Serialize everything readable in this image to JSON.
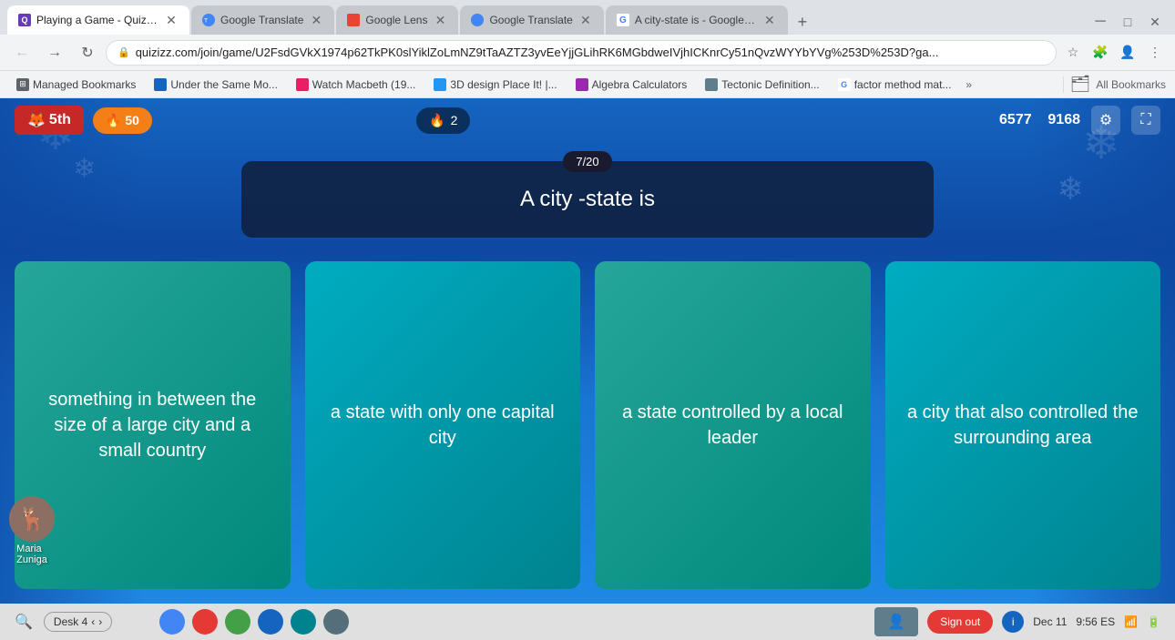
{
  "browser": {
    "tabs": [
      {
        "id": "tab1",
        "title": "Playing a Game - Quizizz",
        "favicon_type": "quizizz",
        "active": true
      },
      {
        "id": "tab2",
        "title": "Google Translate",
        "favicon_type": "google-translate",
        "active": false
      },
      {
        "id": "tab3",
        "title": "Google Lens",
        "favicon_type": "google-lens",
        "active": false
      },
      {
        "id": "tab4",
        "title": "Google Translate",
        "favicon_type": "google-translate",
        "active": false
      },
      {
        "id": "tab5",
        "title": "A city-state is - Google Search",
        "favicon_type": "google",
        "active": false
      }
    ],
    "address": "quizizz.com/join/game/U2FsdGVkX1974p62TkPK0slYiklZoLmNZ9tTaAZTZ3yvEeYjjGLihRK6MGbdweIVjhICKnrCy51nQvzWYYbYVg%253D%253D?ga...",
    "bookmarks": [
      {
        "label": "Managed Bookmarks",
        "favicon": "grid"
      },
      {
        "label": "Under the Same Mo...",
        "favicon": "doc"
      },
      {
        "label": "Watch Macbeth (19...",
        "favicon": "video"
      },
      {
        "label": "3D design Place It! |...",
        "favicon": "3d"
      },
      {
        "label": "Algebra Calculators",
        "favicon": "calc"
      },
      {
        "label": "Tectonic Definition...",
        "favicon": "wiki"
      },
      {
        "label": "factor method mat...",
        "favicon": "google"
      }
    ],
    "bookmarks_right": "All Bookmarks"
  },
  "game": {
    "rank": "5th",
    "rank_icon": "🦊",
    "coins": 50,
    "coins_icon": "🔥",
    "streak": 2,
    "streak_icon": "🔥",
    "score_left": "6577",
    "score_right": "9168",
    "question_counter": "7/20",
    "question_text": "A city -state is",
    "answers": [
      {
        "id": "a1",
        "text": "something in between the size of a large city and a small country"
      },
      {
        "id": "a2",
        "text": "a state with only one capital city"
      },
      {
        "id": "a3",
        "text": "a state controlled by a local leader"
      },
      {
        "id": "a4",
        "text": "a city that also controlled the surrounding area"
      }
    ],
    "player_name": "Maria\nZuniga"
  },
  "taskbar": {
    "desk_label": "Desk 4",
    "sign_out": "Sign out",
    "time": "9:56",
    "am_pm": "ES",
    "date": "Dec 11",
    "search_placeholder": "Search"
  },
  "icons": {
    "back": "←",
    "forward": "→",
    "reload": "↻",
    "home": "⌂",
    "lock": "🔒",
    "star": "☆",
    "extensions": "🧩",
    "profile": "👤",
    "menu": "⋮",
    "settings": "⚙",
    "expand": "⛶",
    "close": "✕",
    "chevron_right": "›",
    "chevron_left": "‹"
  }
}
